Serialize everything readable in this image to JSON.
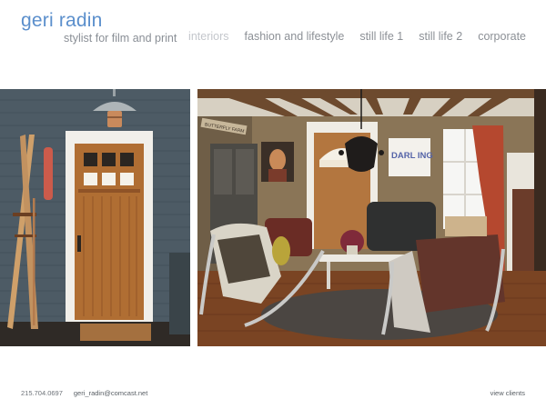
{
  "brand": {
    "name": "geri radin",
    "tagline": "stylist for film and print"
  },
  "nav": {
    "items": [
      {
        "label": "interiors",
        "active": true
      },
      {
        "label": "fashion and lifestyle",
        "active": false
      },
      {
        "label": "still life 1",
        "active": false
      },
      {
        "label": "still life 2",
        "active": false
      },
      {
        "label": "corporate",
        "active": false
      }
    ]
  },
  "photos": {
    "left": {
      "subject": "door-with-skis"
    },
    "right": {
      "subject": "living-room-interior",
      "sign_text_1": "BUTTERFLY FARM",
      "print_text": "DARL ING"
    }
  },
  "footer": {
    "phone": "215.704.0697",
    "email": "geri_radin@comcast.net",
    "clients_link": "view clients"
  },
  "colors": {
    "brand_blue": "#5b8fcc",
    "nav_gray": "#8c9096",
    "nav_active": "#c4c7cc"
  }
}
